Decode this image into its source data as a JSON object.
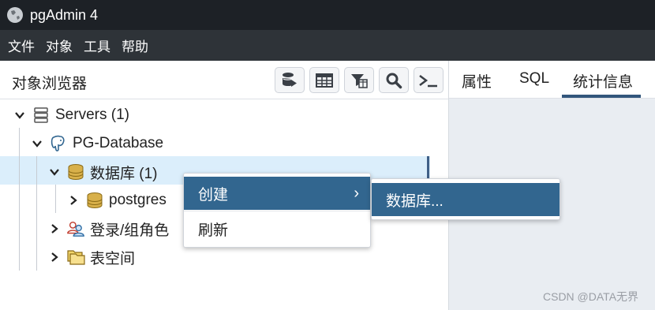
{
  "window": {
    "title": "pgAdmin 4"
  },
  "menubar": {
    "items": [
      "文件",
      "对象",
      "工具",
      "帮助"
    ]
  },
  "browser": {
    "title": "对象浏览器",
    "toolbar_icons": [
      "query-tool-database-icon",
      "table-view-icon",
      "filtered-rows-icon",
      "search-objects-icon",
      "psql-terminal-icon"
    ]
  },
  "tree": {
    "servers": "Servers (1)",
    "server": "PG-Database",
    "databases": "数据库 (1)",
    "db_postgres": "postgres",
    "login_roles": "登录/组角色",
    "tablespaces": "表空间"
  },
  "tabs": {
    "properties": "属性",
    "sql": "SQL",
    "statistics": "统计信息",
    "active": "统计信息"
  },
  "context_menu": {
    "create": "创建",
    "refresh": "刷新",
    "submenu_database": "数据库..."
  },
  "watermark": "CSDN @DATA无界",
  "colors": {
    "titlebar": "#1d2126",
    "menubar": "#2e3338",
    "accent": "#32668f",
    "selected_row": "#dbeefb"
  }
}
